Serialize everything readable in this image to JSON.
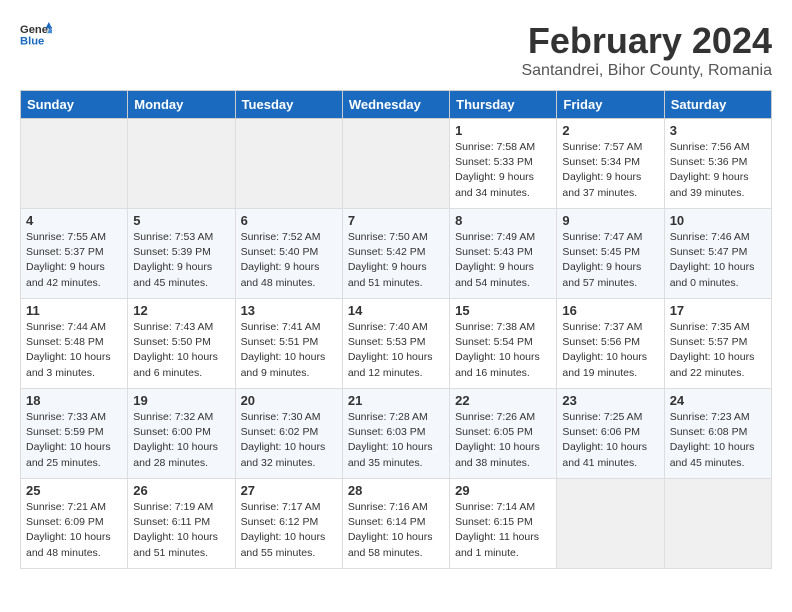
{
  "header": {
    "logo_general": "General",
    "logo_blue": "Blue",
    "title": "February 2024",
    "subtitle": "Santandrei, Bihor County, Romania"
  },
  "weekdays": [
    "Sunday",
    "Monday",
    "Tuesday",
    "Wednesday",
    "Thursday",
    "Friday",
    "Saturday"
  ],
  "weeks": [
    [
      {
        "day": "",
        "info": ""
      },
      {
        "day": "",
        "info": ""
      },
      {
        "day": "",
        "info": ""
      },
      {
        "day": "",
        "info": ""
      },
      {
        "day": "1",
        "info": "Sunrise: 7:58 AM\nSunset: 5:33 PM\nDaylight: 9 hours\nand 34 minutes."
      },
      {
        "day": "2",
        "info": "Sunrise: 7:57 AM\nSunset: 5:34 PM\nDaylight: 9 hours\nand 37 minutes."
      },
      {
        "day": "3",
        "info": "Sunrise: 7:56 AM\nSunset: 5:36 PM\nDaylight: 9 hours\nand 39 minutes."
      }
    ],
    [
      {
        "day": "4",
        "info": "Sunrise: 7:55 AM\nSunset: 5:37 PM\nDaylight: 9 hours\nand 42 minutes."
      },
      {
        "day": "5",
        "info": "Sunrise: 7:53 AM\nSunset: 5:39 PM\nDaylight: 9 hours\nand 45 minutes."
      },
      {
        "day": "6",
        "info": "Sunrise: 7:52 AM\nSunset: 5:40 PM\nDaylight: 9 hours\nand 48 minutes."
      },
      {
        "day": "7",
        "info": "Sunrise: 7:50 AM\nSunset: 5:42 PM\nDaylight: 9 hours\nand 51 minutes."
      },
      {
        "day": "8",
        "info": "Sunrise: 7:49 AM\nSunset: 5:43 PM\nDaylight: 9 hours\nand 54 minutes."
      },
      {
        "day": "9",
        "info": "Sunrise: 7:47 AM\nSunset: 5:45 PM\nDaylight: 9 hours\nand 57 minutes."
      },
      {
        "day": "10",
        "info": "Sunrise: 7:46 AM\nSunset: 5:47 PM\nDaylight: 10 hours\nand 0 minutes."
      }
    ],
    [
      {
        "day": "11",
        "info": "Sunrise: 7:44 AM\nSunset: 5:48 PM\nDaylight: 10 hours\nand 3 minutes."
      },
      {
        "day": "12",
        "info": "Sunrise: 7:43 AM\nSunset: 5:50 PM\nDaylight: 10 hours\nand 6 minutes."
      },
      {
        "day": "13",
        "info": "Sunrise: 7:41 AM\nSunset: 5:51 PM\nDaylight: 10 hours\nand 9 minutes."
      },
      {
        "day": "14",
        "info": "Sunrise: 7:40 AM\nSunset: 5:53 PM\nDaylight: 10 hours\nand 12 minutes."
      },
      {
        "day": "15",
        "info": "Sunrise: 7:38 AM\nSunset: 5:54 PM\nDaylight: 10 hours\nand 16 minutes."
      },
      {
        "day": "16",
        "info": "Sunrise: 7:37 AM\nSunset: 5:56 PM\nDaylight: 10 hours\nand 19 minutes."
      },
      {
        "day": "17",
        "info": "Sunrise: 7:35 AM\nSunset: 5:57 PM\nDaylight: 10 hours\nand 22 minutes."
      }
    ],
    [
      {
        "day": "18",
        "info": "Sunrise: 7:33 AM\nSunset: 5:59 PM\nDaylight: 10 hours\nand 25 minutes."
      },
      {
        "day": "19",
        "info": "Sunrise: 7:32 AM\nSunset: 6:00 PM\nDaylight: 10 hours\nand 28 minutes."
      },
      {
        "day": "20",
        "info": "Sunrise: 7:30 AM\nSunset: 6:02 PM\nDaylight: 10 hours\nand 32 minutes."
      },
      {
        "day": "21",
        "info": "Sunrise: 7:28 AM\nSunset: 6:03 PM\nDaylight: 10 hours\nand 35 minutes."
      },
      {
        "day": "22",
        "info": "Sunrise: 7:26 AM\nSunset: 6:05 PM\nDaylight: 10 hours\nand 38 minutes."
      },
      {
        "day": "23",
        "info": "Sunrise: 7:25 AM\nSunset: 6:06 PM\nDaylight: 10 hours\nand 41 minutes."
      },
      {
        "day": "24",
        "info": "Sunrise: 7:23 AM\nSunset: 6:08 PM\nDaylight: 10 hours\nand 45 minutes."
      }
    ],
    [
      {
        "day": "25",
        "info": "Sunrise: 7:21 AM\nSunset: 6:09 PM\nDaylight: 10 hours\nand 48 minutes."
      },
      {
        "day": "26",
        "info": "Sunrise: 7:19 AM\nSunset: 6:11 PM\nDaylight: 10 hours\nand 51 minutes."
      },
      {
        "day": "27",
        "info": "Sunrise: 7:17 AM\nSunset: 6:12 PM\nDaylight: 10 hours\nand 55 minutes."
      },
      {
        "day": "28",
        "info": "Sunrise: 7:16 AM\nSunset: 6:14 PM\nDaylight: 10 hours\nand 58 minutes."
      },
      {
        "day": "29",
        "info": "Sunrise: 7:14 AM\nSunset: 6:15 PM\nDaylight: 11 hours\nand 1 minute."
      },
      {
        "day": "",
        "info": ""
      },
      {
        "day": "",
        "info": ""
      }
    ]
  ]
}
